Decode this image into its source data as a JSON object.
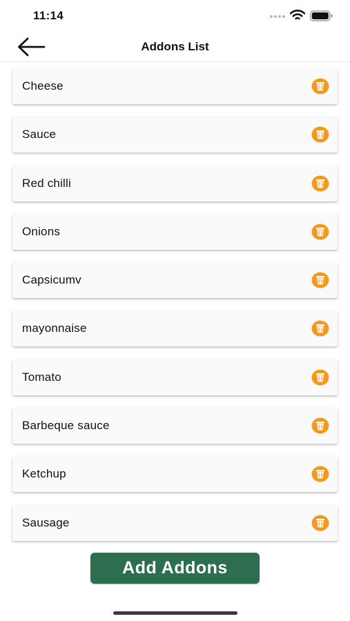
{
  "status_bar": {
    "time": "11:14"
  },
  "header": {
    "title": "Addons List",
    "back_icon": "arrow-left-icon"
  },
  "addons": [
    {
      "name": "Cheese"
    },
    {
      "name": "Sauce"
    },
    {
      "name": "Red chilli"
    },
    {
      "name": "Onions"
    },
    {
      "name": "Capsicumv"
    },
    {
      "name": "mayonnaise"
    },
    {
      "name": "Tomato"
    },
    {
      "name": "Barbeque sauce"
    },
    {
      "name": "Ketchup"
    },
    {
      "name": "Sausage"
    }
  ],
  "delete_icon": "trash-icon",
  "add_button_label": "Add Addons",
  "colors": {
    "accent_orange": "#f39a1e",
    "primary_green": "#2c6e4f"
  }
}
